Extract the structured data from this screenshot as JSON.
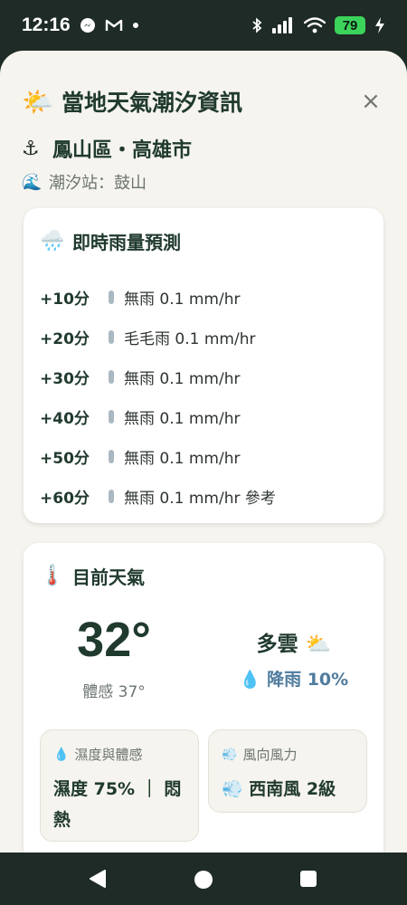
{
  "status_bar": {
    "time": "12:16",
    "notification_icons": [
      "messenger-icon",
      "gmail-icon",
      "dot-icon"
    ],
    "battery": "79"
  },
  "header": {
    "emoji": "🌤️",
    "title": "當地天氣潮汐資訊",
    "close": "×"
  },
  "location": {
    "emoji": "⚓",
    "name": "鳳山區・高雄市"
  },
  "station": {
    "emoji": "🌊",
    "label": "潮汐站：鼓山"
  },
  "rain_forecast": {
    "emoji": "🌧️",
    "title": "即時雨量預測",
    "rows": [
      {
        "time": "+10分",
        "desc": "無雨 0.1 mm/hr"
      },
      {
        "time": "+20分",
        "desc": "毛毛雨 0.1 mm/hr"
      },
      {
        "time": "+30分",
        "desc": "無雨 0.1 mm/hr"
      },
      {
        "time": "+40分",
        "desc": "無雨 0.1 mm/hr"
      },
      {
        "time": "+50分",
        "desc": "無雨 0.1 mm/hr"
      },
      {
        "time": "+60分",
        "desc": "無雨 0.1 mm/hr 參考"
      }
    ]
  },
  "current_weather": {
    "emoji": "🌡️",
    "title": "目前天氣",
    "temperature": "32°",
    "feels_like": "體感 37°",
    "condition": "多雲 ⛅",
    "rain_chance": "💧 降雨 10%",
    "humidity_card": {
      "emoji": "💧",
      "label": "濕度與體感",
      "value": "濕度 75% ｜ 悶熱"
    },
    "wind_card": {
      "emoji": "💨",
      "label": "風向風力",
      "value": "💨 西南風 2級"
    }
  },
  "colors": {
    "status_bg": "#1e2b26",
    "sheet_bg": "#f6f4ee",
    "card_bg": "#ffffff",
    "title_text": "#203a2e",
    "muted_text": "#6c7570",
    "rain_bar": "#aab8c2",
    "rain_chance": "#4f7c9e",
    "battery": "#3cd35b"
  }
}
